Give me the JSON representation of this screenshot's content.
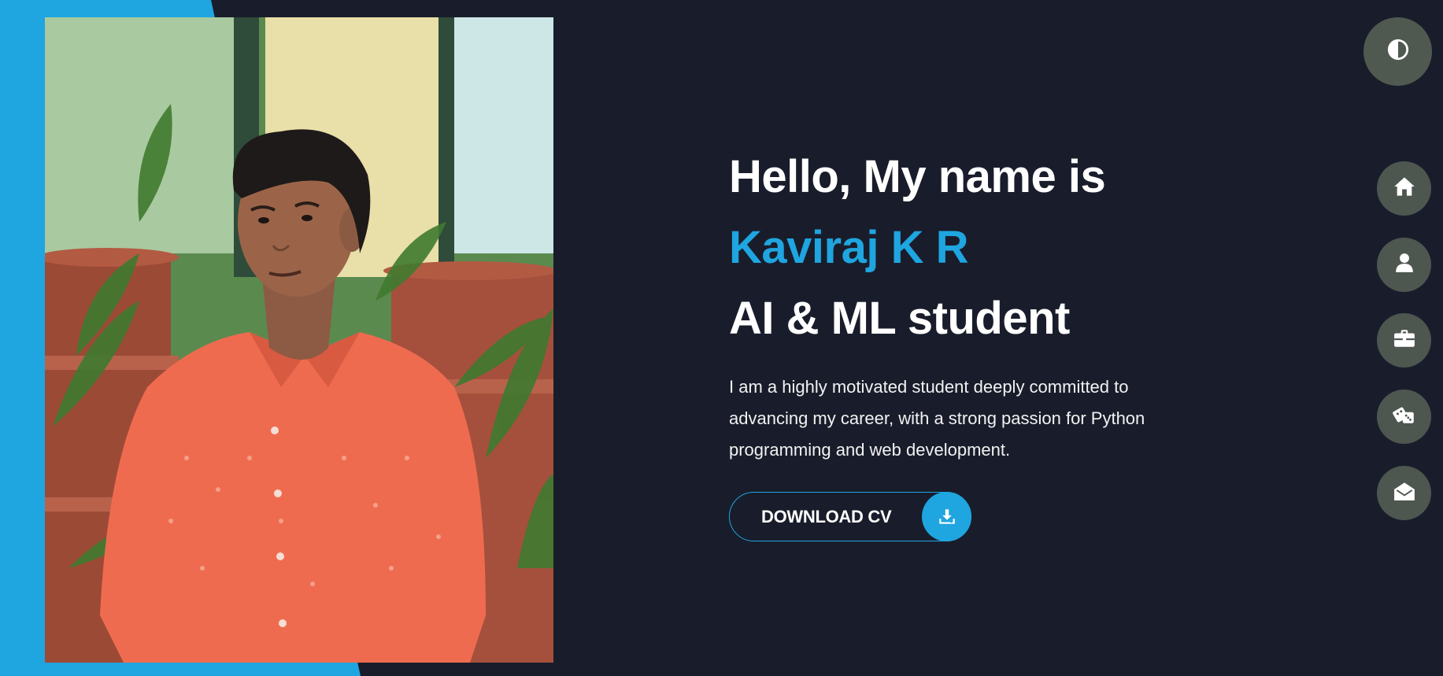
{
  "hero": {
    "greeting": "Hello, My name is",
    "name": "Kaviraj K R",
    "role": "AI & ML student",
    "bio": "I am a highly motivated student deeply committed to advancing my career, with a strong passion for Python programming and web development."
  },
  "cv_button": {
    "label": "DOWNLOAD CV",
    "icon": "download-icon"
  },
  "theme_toggle": {
    "icon": "contrast-icon"
  },
  "nav": [
    {
      "id": "home",
      "icon": "home-icon"
    },
    {
      "id": "about",
      "icon": "user-icon"
    },
    {
      "id": "portfolio",
      "icon": "briefcase-icon"
    },
    {
      "id": "skills",
      "icon": "dice-icon"
    },
    {
      "id": "contact",
      "icon": "envelope-open-icon"
    }
  ],
  "colors": {
    "background": "#191d2b",
    "accent": "#1fa5e0",
    "nav_button": "#4d564f",
    "nav_icon": "#ffffff"
  }
}
